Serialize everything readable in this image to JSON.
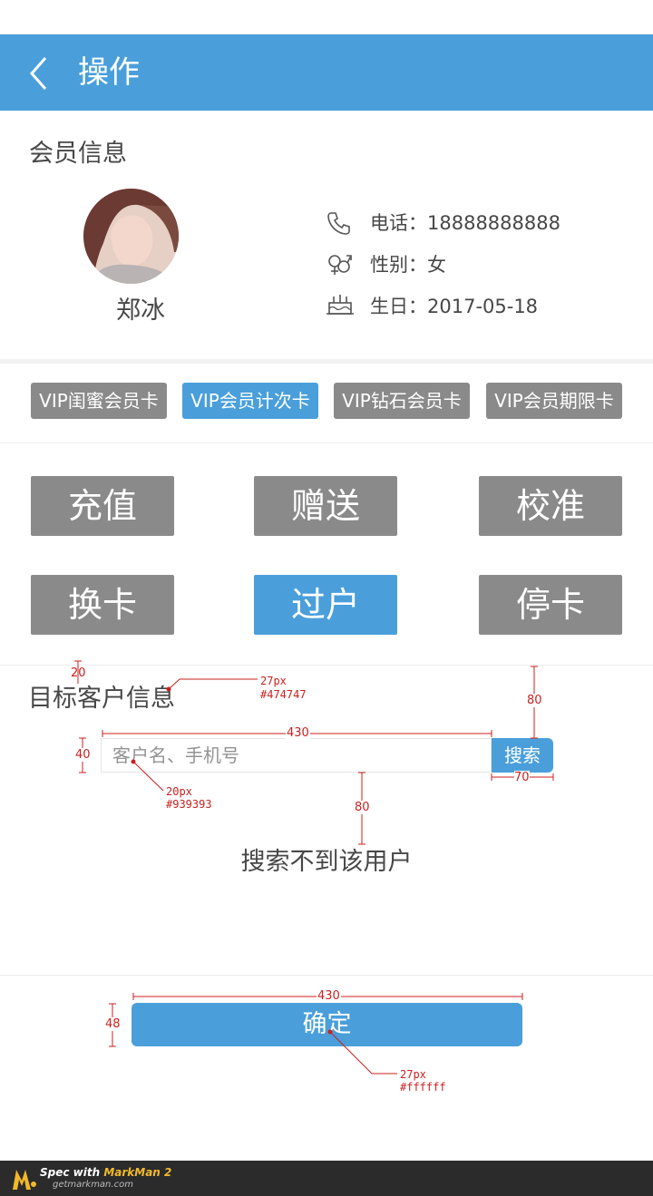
{
  "header": {
    "title": "操作"
  },
  "member": {
    "section_title": "会员信息",
    "name": "郑冰",
    "phone": "电话：18888888888",
    "gender": "性别：女",
    "birthday": "生日：2017-05-18"
  },
  "cards": [
    {
      "label": "VIP闺蜜会员卡",
      "active": false
    },
    {
      "label": "VIP会员计次卡",
      "active": true
    },
    {
      "label": "VIP钻石会员卡",
      "active": false
    },
    {
      "label": "VIP会员期限卡",
      "active": false
    }
  ],
  "operations": [
    {
      "label": "充值",
      "active": false
    },
    {
      "label": "赠送",
      "active": false
    },
    {
      "label": "校准",
      "active": false
    },
    {
      "label": "换卡",
      "active": false
    },
    {
      "label": "过户",
      "active": true
    },
    {
      "label": "停卡",
      "active": false
    }
  ],
  "target": {
    "section_title": "目标客户信息",
    "search_placeholder": "客户名、手机号",
    "search_button": "搜索",
    "empty_message": "搜索不到该用户"
  },
  "confirm": {
    "label": "确定"
  },
  "annotations": {
    "a20": "20",
    "a27px_1": "27px",
    "a474747": "#474747",
    "a80_right": "80",
    "a430_top": "430",
    "a40": "40",
    "a70": "70",
    "a20px": "20px",
    "a939393": "#939393",
    "a80_mid": "80",
    "a430_bottom": "430",
    "a48": "48",
    "a27px_2": "27px",
    "affffff": "#ffffff"
  },
  "footer": {
    "text_prefix": "Spec with ",
    "brand": "MarkMan 2",
    "url": "getmarkman.com"
  },
  "colors": {
    "accent": "#4a9fdb",
    "gray_button": "#8a8a8a",
    "text": "#474747",
    "placeholder": "#939393"
  }
}
